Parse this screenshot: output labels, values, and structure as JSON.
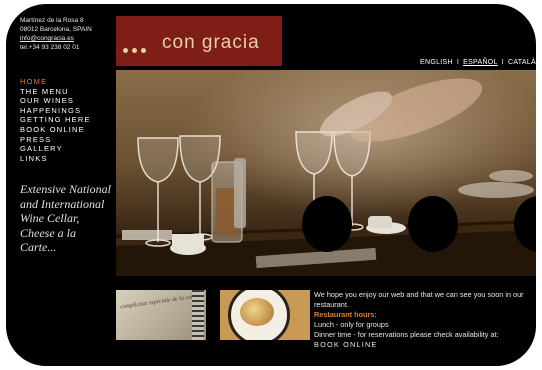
{
  "address": {
    "street": "Martínez de la Rosa 8",
    "city": "08012 Barcelona, SPAIN",
    "email": "info@congracia.es",
    "phone": "tel.+34 93 238 02 01"
  },
  "nav": {
    "items": [
      "HOME",
      "THE MENU",
      "OUR WINES",
      "HAPPENINGS",
      "GETTING HERE",
      "BOOK ONLINE",
      "PRESS",
      "GALLERY",
      "LINKS"
    ],
    "active_index": 0
  },
  "tagline": "Extensive National and International Wine Cellar, Cheese a la Carte...",
  "logo": {
    "text": "con gracia"
  },
  "languages": {
    "items": [
      "ENGLISH",
      "ESPAÑOL",
      "CATALÀ"
    ],
    "separator": "I",
    "selected": "ESPAÑOL"
  },
  "thumb1": {
    "caption": "complicitat espéciale de la cuina"
  },
  "info": {
    "welcome": "We hope you enjoy our web and that we can see you soon in our restaurant.",
    "hours_title": "Restaurant hours:",
    "lunch": "Lunch - only for groups",
    "dinner": "Dinner time - for reservations please check availability at:",
    "book_link": "BOOK ONLINE"
  },
  "colors": {
    "logo_bg": "#7e1e16",
    "logo_text": "#e7d3a3",
    "accent": "#e07b2a",
    "page_bg": "#000000"
  }
}
